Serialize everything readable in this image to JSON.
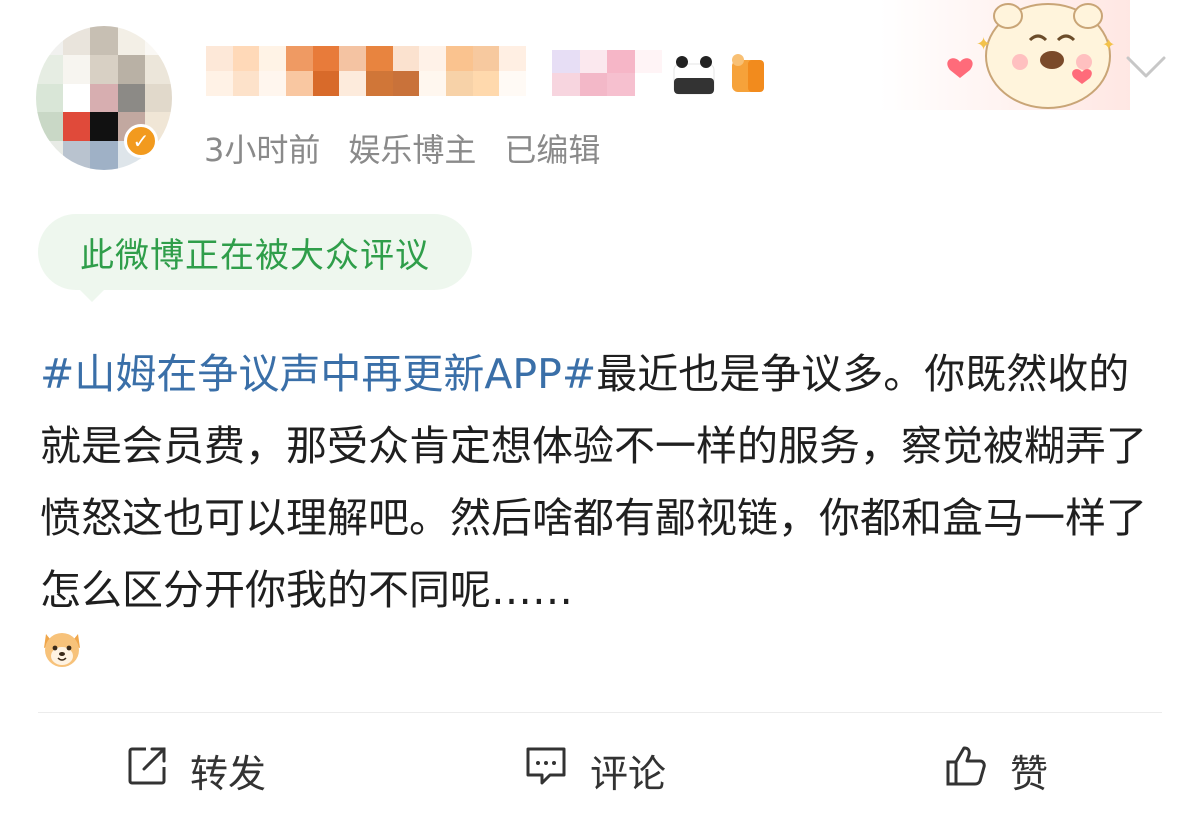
{
  "post": {
    "meta": {
      "time": "3小时前",
      "role": "娱乐博主",
      "edited": "已编辑"
    },
    "tip": "此微博正在被大众评议",
    "topic": "#山姆在争议声中再更新APP#",
    "body": "最近也是争议多。你既然收的就是会员费，那受众肯定想体验不一样的服务，察觉被糊弄了愤怒这也可以理解吧。然后啥都有鄙视链，你都和盒马一样了怎么区分开你我的不同呢……"
  },
  "actions": {
    "repost": "转发",
    "comment": "评论",
    "like": "赞"
  },
  "icons": {
    "menu": "chevron-down-icon",
    "verified": "verified-badge-icon",
    "repost": "share-icon",
    "comment": "comment-icon",
    "like": "thumbs-up-icon",
    "emoji": "dog-emoji-icon"
  },
  "colors": {
    "topic": "#3a6fa8",
    "tip_text": "#2f9e4a",
    "tip_bg": "#eef7ee",
    "meta": "#8a8a8a"
  }
}
